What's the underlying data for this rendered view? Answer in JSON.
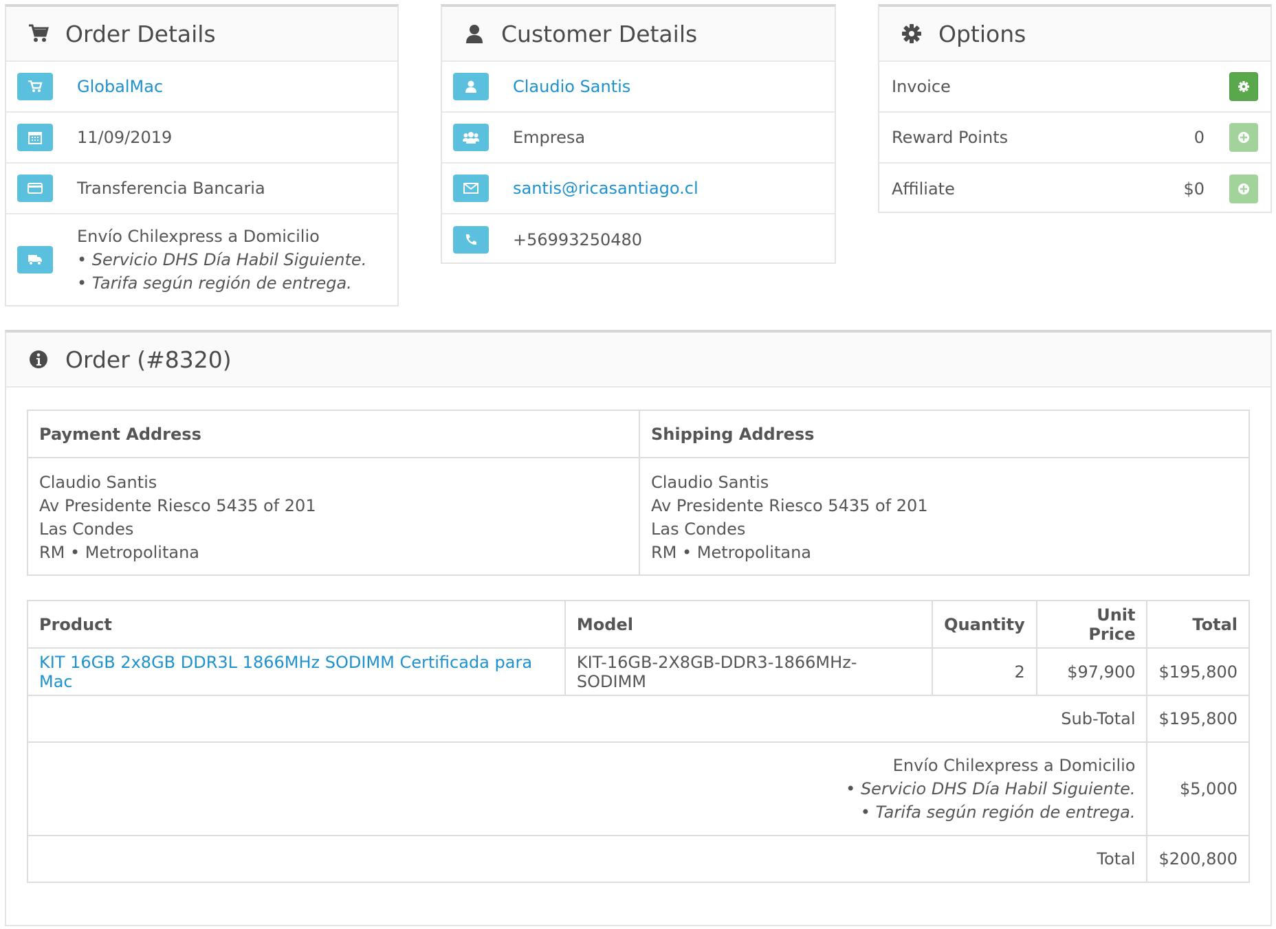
{
  "order_details": {
    "title": "Order Details",
    "store": "GlobalMac",
    "date": "11/09/2019",
    "payment_method": "Transferencia Bancaria",
    "shipping_method": {
      "line1": "Envío Chilexpress a Domicilio",
      "line2": "• Servicio DHS Día Habil Siguiente.",
      "line3": "• Tarifa según región de entrega."
    }
  },
  "customer_details": {
    "title": "Customer Details",
    "name": "Claudio Santis",
    "group": "Empresa",
    "email": "santis@ricasantiago.cl",
    "phone": "+56993250480"
  },
  "options": {
    "title": "Options",
    "rows": [
      {
        "label": "Invoice",
        "value": ""
      },
      {
        "label": "Reward Points",
        "value": "0"
      },
      {
        "label": "Affiliate",
        "value": "$0"
      }
    ]
  },
  "order": {
    "title": "Order (#8320)",
    "payment_address": {
      "header": "Payment Address",
      "lines": [
        "Claudio Santis",
        "Av Presidente Riesco 5435 of 201",
        "Las Condes",
        "RM • Metropolitana"
      ]
    },
    "shipping_address": {
      "header": "Shipping Address",
      "lines": [
        "Claudio Santis",
        "Av Presidente Riesco 5435 of 201",
        "Las Condes",
        "RM • Metropolitana"
      ]
    },
    "columns": {
      "product": "Product",
      "model": "Model",
      "quantity": "Quantity",
      "unit_price": "Unit Price",
      "total": "Total"
    },
    "item": {
      "product": "KIT 16GB 2x8GB DDR3L 1866MHz SODIMM Certificada para Mac",
      "model": "KIT-16GB-2X8GB-DDR3-1866MHz-SODIMM",
      "quantity": "2",
      "unit_price": "$97,900",
      "total": "$195,800"
    },
    "subtotal": {
      "label": "Sub-Total",
      "value": "$195,800"
    },
    "shipping": {
      "line1": "Envío Chilexpress a Domicilio",
      "line2": "• Servicio DHS Día Habil Siguiente.",
      "line3": "• Tarifa según región de entrega.",
      "value": "$5,000"
    },
    "grand_total": {
      "label": "Total",
      "value": "$200,800"
    }
  },
  "colors": {
    "info": "#5bc0de",
    "link": "#1e91cf",
    "success": "#5aa84c"
  }
}
